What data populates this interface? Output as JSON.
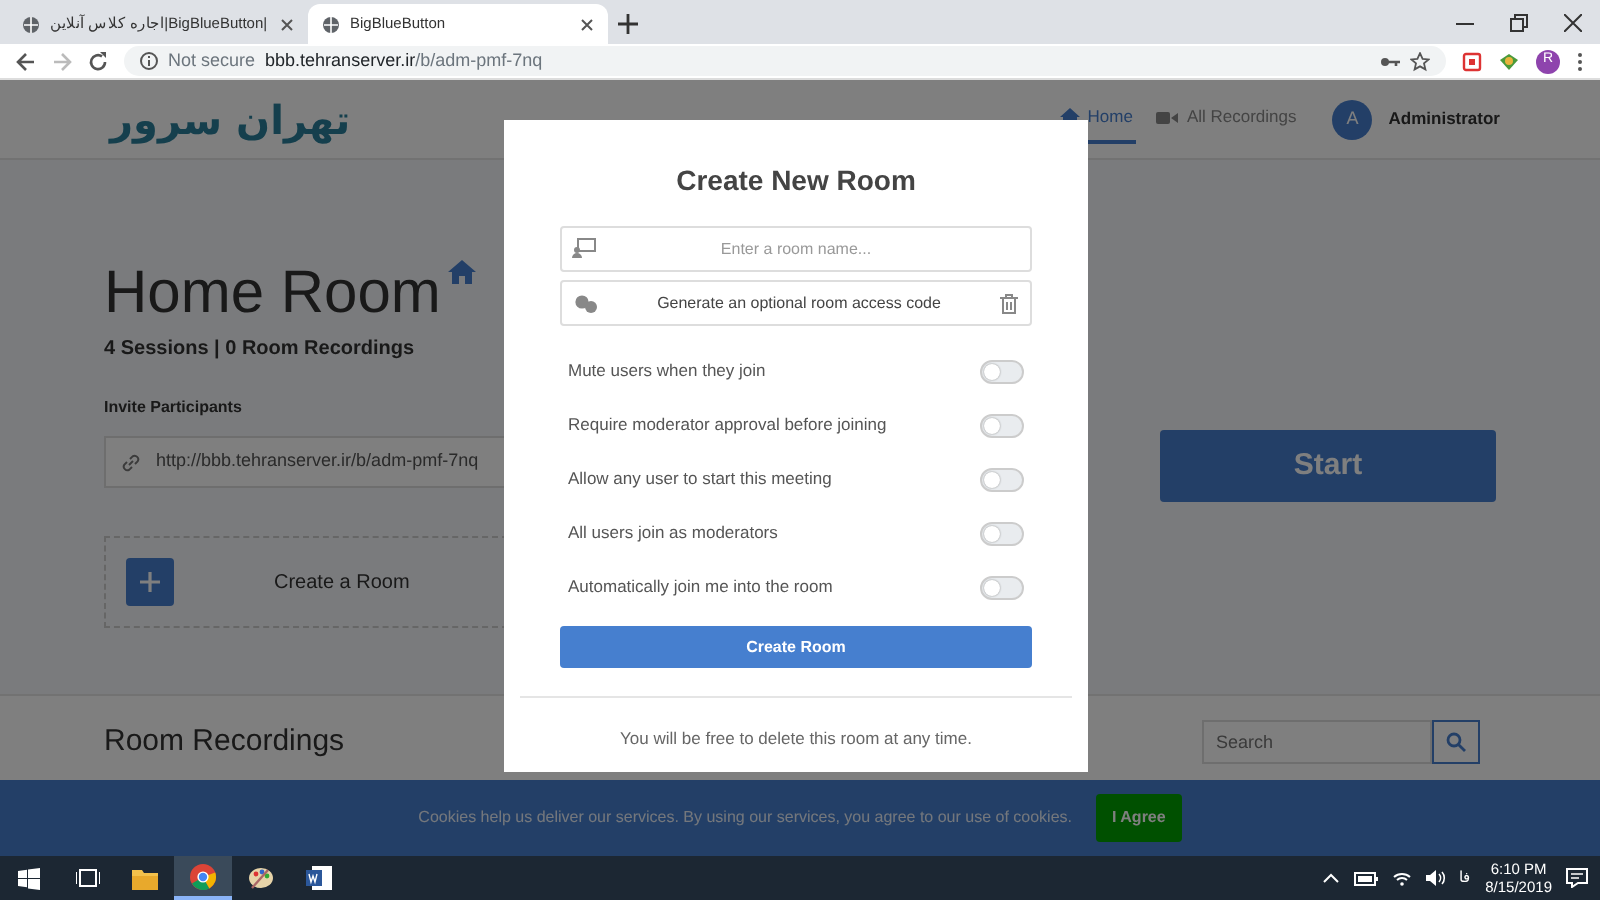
{
  "browser": {
    "tabs": [
      {
        "title": "اجاره کلاس آنلاین|BigBlueButton|",
        "selected": false
      },
      {
        "title": "BigBlueButton",
        "selected": true
      }
    ],
    "security": "Not secure",
    "url_host": "bbb.tehranserver.ir",
    "url_path": "/b/adm-pmf-7nq",
    "profile_initial": "R"
  },
  "navbar": {
    "logo": "تهران سرور",
    "items": [
      {
        "label": "Home",
        "kind": "home",
        "selected": true
      },
      {
        "label": "All Recordings",
        "kind": "video",
        "selected": false
      }
    ],
    "avatar": "A",
    "user": "Administrator"
  },
  "room": {
    "title": "Home Room",
    "stats": "4 Sessions | 0 Room Recordings",
    "invite_label": "Invite Participants",
    "invite_url": "http://bbb.tehranserver.ir/b/adm-pmf-7nq",
    "create_room": "Create a Room",
    "start": "Start"
  },
  "recordings": {
    "heading": "Room Recordings",
    "search_placeholder": "Search"
  },
  "modal": {
    "title": "Create New Room",
    "name_placeholder": "Enter a room name...",
    "access_code": "Generate an optional room access code",
    "settings": [
      {
        "label": "Mute users when they join",
        "on": false
      },
      {
        "label": "Require moderator approval before joining",
        "on": false
      },
      {
        "label": "Allow any user to start this meeting",
        "on": false
      },
      {
        "label": "All users join as moderators",
        "on": false
      },
      {
        "label": "Automatically join me into the room",
        "on": false
      }
    ],
    "submit": "Create Room",
    "footer": "You will be free to delete this room at any time."
  },
  "cookie_banner": {
    "text": "Cookies help us deliver our services. By using our services, you agree to our use of cookies.",
    "button": "I Agree"
  },
  "taskbar": {
    "apps": [
      {
        "kind": "folder",
        "selected": false
      },
      {
        "kind": "browser",
        "selected": true
      },
      {
        "kind": "paint",
        "selected": false
      },
      {
        "kind": "word",
        "selected": false
      }
    ],
    "language": "فا",
    "time": "6:10 PM",
    "date": "8/15/2019"
  }
}
